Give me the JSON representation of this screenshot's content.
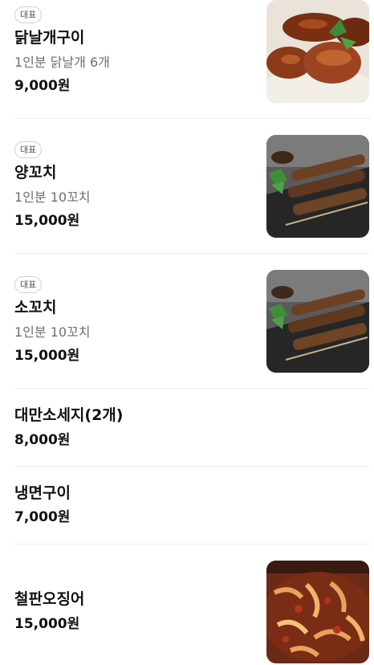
{
  "menu": {
    "items": [
      {
        "badge": "대표",
        "name": "닭날개구이",
        "description": "1인분 닭날개 6개",
        "price": "9,000원",
        "image": "chicken-wings-image"
      },
      {
        "badge": "대표",
        "name": "양꼬치",
        "description": "1인분 10꼬치",
        "price": "15,000원",
        "image": "lamb-skewers-image"
      },
      {
        "badge": "대표",
        "name": "소꼬치",
        "description": "1인분 10꼬치",
        "price": "15,000원",
        "image": "beef-skewers-image"
      },
      {
        "name": "대만소세지(2개)",
        "price": "8,000원"
      },
      {
        "name": "냉면구이",
        "price": "7,000원"
      },
      {
        "name": "철판오징어",
        "price": "15,000원",
        "image": "stir-fried-squid-image"
      }
    ]
  }
}
